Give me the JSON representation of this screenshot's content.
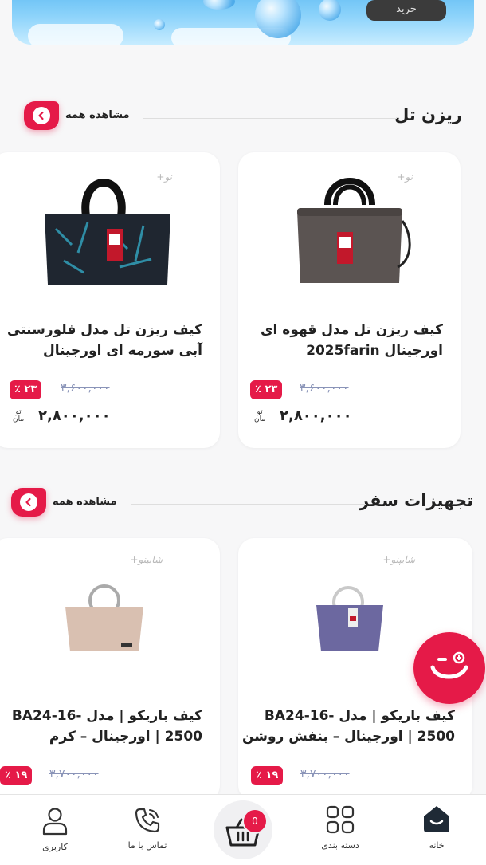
{
  "banner": {
    "buy_label": "خرید"
  },
  "sections": [
    {
      "title": "ریزن تل",
      "see_all": "مشاهده همه",
      "products": [
        {
          "tag": "نو+",
          "name_line1": "کیف ریزن تل مدل قهوه ای",
          "name_line2": "اورجینال 2025farin",
          "old_price": "۳,۶۰۰,۰۰۰",
          "discount": "۲۳ ٪",
          "price": "۲,۸۰۰,۰۰۰",
          "currency_line1": "تو",
          "currency_line2": "مان",
          "bag_color": "#5b5452"
        },
        {
          "tag": "نو+",
          "name_line1": "کیف ریزن تل مدل فلورسنتی",
          "name_line2": "آبی سورمه ای اورجینال",
          "old_price": "۳,۶۰۰,۰۰۰",
          "discount": "۲۳ ٪",
          "price": "۲,۸۰۰,۰۰۰",
          "currency_line1": "تو",
          "currency_line2": "مان",
          "bag_color": "#1f2630"
        }
      ]
    },
    {
      "title": "تجهیزات سفر",
      "see_all": "مشاهده همه",
      "products": [
        {
          "tag": "شایپنو+",
          "name_line1": "کیف باریکو | مدل -BA24-16",
          "name_line2": "2500 | اورجینال – بنفش روشن",
          "old_price": "۳,۷۰۰,۰۰۰",
          "discount": "۱۹ ٪",
          "bag_color": "#6c68a0"
        },
        {
          "tag": "شایپنو+",
          "name_line1": "کیف باریکو | مدل -BA24-16",
          "name_line2": "2500 | اورجینال – کرم",
          "old_price": "۳,۷۰۰,۰۰۰",
          "discount": "۱۹ ٪",
          "bag_color": "#d9c0b1"
        }
      ]
    }
  ],
  "bottom_nav": {
    "home": "خانه",
    "categories": "دسته بندی",
    "cart_count": "0",
    "contact": "تماس با ما",
    "account": "کاربری"
  },
  "colors": {
    "accent": "#e51a48",
    "background": "#f7f7f8"
  }
}
